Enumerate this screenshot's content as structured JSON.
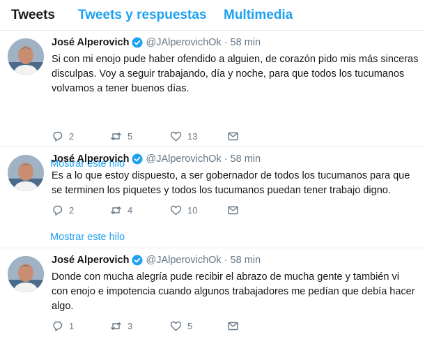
{
  "tabs": [
    "Tweets",
    "Tweets y respuestas",
    "Multimedia"
  ],
  "tweets": [
    {
      "name": "José Alperovich",
      "handle": "@JAlperovichOk",
      "time": "58 min",
      "lines": [
        "Si con mi enojo pude haber ofendido a alguien, de corazón pido mis más sinceras",
        "disculpas. Voy a seguir trabajando, día y noche, para que todos los tucumanos",
        "volvamos a tener buenos días."
      ],
      "replies": "2",
      "retweets": "5",
      "likes": "13",
      "thread": "Mostrar este hilo"
    },
    {
      "name": "José Alperovich",
      "handle": "@JAlperovichOk",
      "time": "58 min",
      "lines": [
        "Es a lo que estoy dispuesto, a ser gobernador de todos los tucumanos para que",
        "se terminen los piquetes y todos los tucumanos puedan tener trabajo digno."
      ],
      "replies": "2",
      "retweets": "4",
      "likes": "10",
      "thread": "Mostrar este hilo"
    },
    {
      "name": "José Alperovich",
      "handle": "@JAlperovichOk",
      "time": "58 min",
      "lines": [
        "Donde con mucha alegría pude recibir el abrazo de mucha gente y también vi",
        "con enojo e impotencia cuando algunos trabajadores me pedían que debía hacer",
        "algo."
      ],
      "replies": "1",
      "retweets": "3",
      "likes": "5"
    }
  ],
  "dot": "·",
  "colors": {
    "accent": "#1da1f2",
    "muted": "#657786",
    "text": "#14171a"
  },
  "icons": [
    "reply-icon",
    "retweet-icon",
    "like-icon",
    "direct-message-icon",
    "verified-badge-icon"
  ]
}
